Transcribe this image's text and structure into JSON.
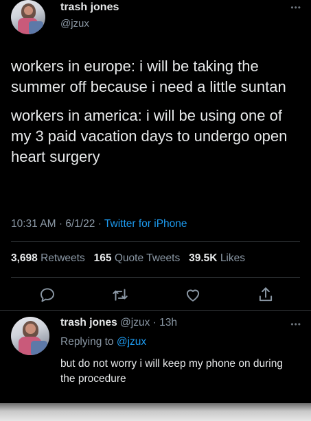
{
  "tweet": {
    "author_name": "trash jones",
    "handle": "@jzux",
    "text_para1": "workers in europe: i will be taking the summer off because i need a little suntan",
    "text_para2": "workers in america: i will be using one of my 3 paid vacation days to undergo open heart surgery",
    "time": "10:31 AM",
    "date": "6/1/22",
    "source": "Twitter for iPhone",
    "retweets_count": "3,698",
    "retweets_label": "Retweets",
    "quote_count": "165",
    "quote_label": "Quote Tweets",
    "likes_count": "39.5K",
    "likes_label": "Likes"
  },
  "reply": {
    "author_name": "trash jones",
    "handle": "@jzux",
    "age": "13h",
    "replying_prefix": "Replying to",
    "replying_to": "@jzux",
    "text": "but do not worry i will keep my phone on during the procedure"
  },
  "icons": {
    "reply": "reply-icon",
    "retweet": "retweet-icon",
    "like": "heart-icon",
    "share": "share-icon",
    "more": "more-icon"
  },
  "colors": {
    "background": "#000000",
    "text": "#e7e9ea",
    "muted": "#8b98a5",
    "accent": "#1d9bf0"
  }
}
